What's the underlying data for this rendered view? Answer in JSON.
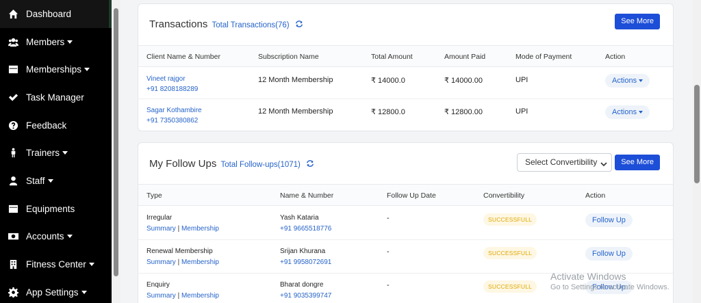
{
  "sidebar": {
    "items": [
      {
        "label": "Dashboard",
        "icon": "home-icon",
        "caret": false
      },
      {
        "label": "Members",
        "icon": "users-icon",
        "caret": true
      },
      {
        "label": "Memberships",
        "icon": "card-icon",
        "caret": true
      },
      {
        "label": "Task Manager",
        "icon": "check-icon",
        "caret": false
      },
      {
        "label": "Feedback",
        "icon": "question-icon",
        "caret": false
      },
      {
        "label": "Trainers",
        "icon": "person-icon",
        "caret": true
      },
      {
        "label": "Staff",
        "icon": "user-icon",
        "caret": true
      },
      {
        "label": "Equipments",
        "icon": "box-icon",
        "caret": false
      },
      {
        "label": "Accounts",
        "icon": "money-icon",
        "caret": true
      },
      {
        "label": "Fitness Center",
        "icon": "building-icon",
        "caret": true
      },
      {
        "label": "App Settings",
        "icon": "gear-icon",
        "caret": true
      }
    ]
  },
  "transactions": {
    "title": "Transactions",
    "total": "Total Transactions(76)",
    "see_more": "See More",
    "headers": [
      "Client Name & Number",
      "Subscription Name",
      "Total Amount",
      "Amount Paid",
      "Mode of Payment",
      "Action"
    ],
    "rows": [
      {
        "name": "Vineet rajgor",
        "phone": "+91 8208188289",
        "subscription": "12 Month Membership",
        "total": "₹ 14000.0",
        "paid": "₹ 14000.00",
        "mode": "UPI",
        "action": "Actions"
      },
      {
        "name": "Sagar Kothambire",
        "phone": "+91 7350380862",
        "subscription": "12 Month Membership",
        "total": "₹ 12800.0",
        "paid": "₹ 12800.00",
        "mode": "UPI",
        "action": "Actions"
      }
    ]
  },
  "followups": {
    "title": "My Follow Ups",
    "total": "Total Follow-ups(1071)",
    "select_value": "Select Convertibility",
    "see_more": "See More",
    "headers": [
      "Type",
      "Name & Number",
      "Follow Up Date",
      "Convertibility",
      "Action"
    ],
    "link_summary": "Summary",
    "link_sep": "|",
    "link_membership": "Membership",
    "rows": [
      {
        "type": "Irregular",
        "name": "Yash Kataria",
        "phone": "+91 9665518776",
        "date": "-",
        "status": "SUCCESSFULL",
        "action": "Follow Up"
      },
      {
        "type": "Renewal Membership",
        "name": "Srijan Khurana",
        "phone": "+91 9958072691",
        "date": "-",
        "status": "SUCCESSFULL",
        "action": "Follow Up"
      },
      {
        "type": "Enquiry",
        "name": "Bharat dongre",
        "phone": "+91 9035399747",
        "date": "-",
        "status": "SUCCESSFULL",
        "action": "Follow Up"
      }
    ]
  },
  "watermark": {
    "line1": "Activate Windows",
    "line2": "Go to Settings to activate Windows."
  },
  "colors": {
    "accent": "#1d4ed8",
    "link": "#2563c9",
    "sidebar_bg": "#000000",
    "badge_text": "#e0a800"
  }
}
